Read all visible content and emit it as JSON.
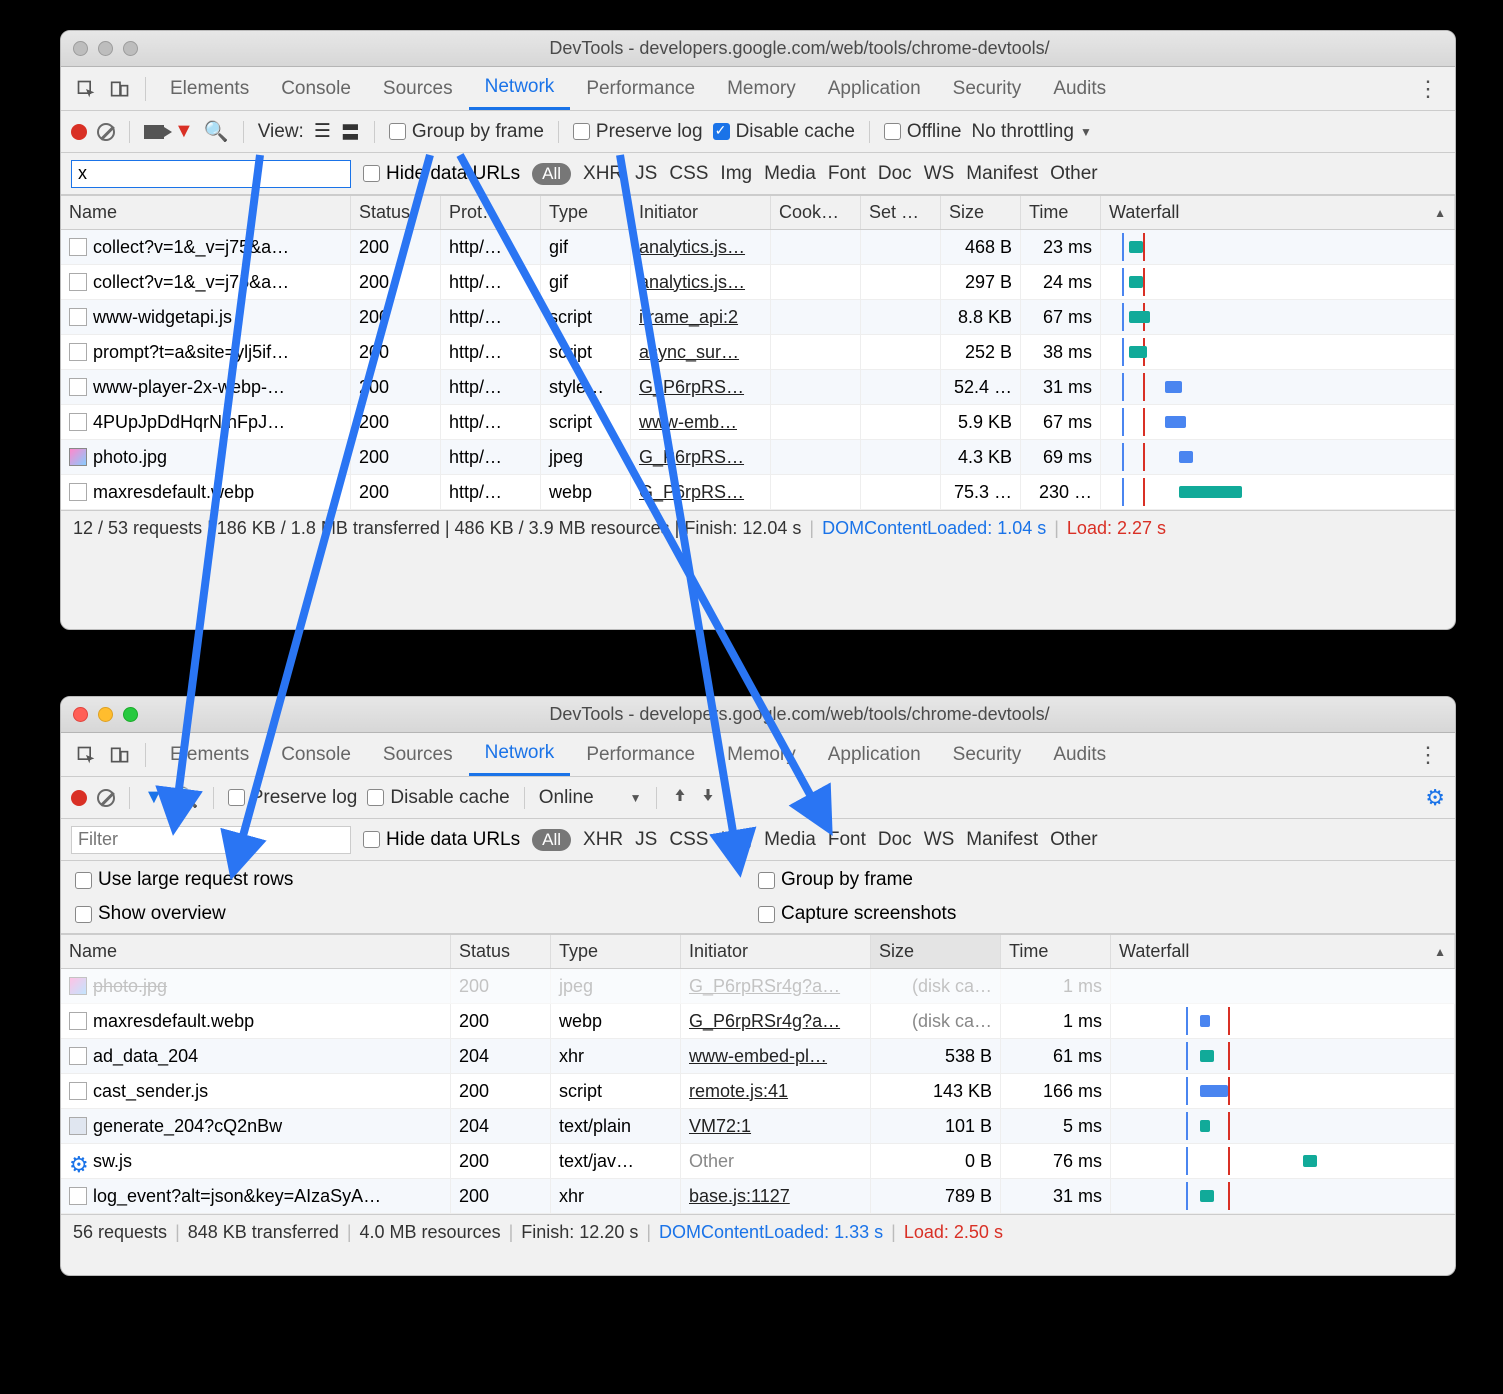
{
  "window1": {
    "title": "DevTools - developers.google.com/web/tools/chrome-devtools/",
    "tabs": [
      "Elements",
      "Console",
      "Sources",
      "Network",
      "Performance",
      "Memory",
      "Application",
      "Security",
      "Audits"
    ],
    "active_tab": "Network",
    "toolbar": {
      "view_label": "View:",
      "group_by_frame": "Group by frame",
      "preserve_log": "Preserve log",
      "disable_cache": "Disable cache",
      "disable_cache_checked": true,
      "offline": "Offline",
      "throttling": "No throttling"
    },
    "filter": {
      "value": "x",
      "hide_data_urls": "Hide data URLs",
      "types": [
        "All",
        "XHR",
        "JS",
        "CSS",
        "Img",
        "Media",
        "Font",
        "Doc",
        "WS",
        "Manifest",
        "Other"
      ]
    },
    "columns": [
      "Name",
      "Status",
      "Prot…",
      "Type",
      "Initiator",
      "Cook…",
      "Set …",
      "Size",
      "Time",
      "Waterfall"
    ],
    "rows": [
      {
        "name": "collect?v=1&_v=j75&a…",
        "status": "200",
        "protocol": "http/…",
        "type": "gif",
        "initiator": "analytics.js…",
        "size": "468 B",
        "time": "23 ms",
        "wf_start": 8,
        "wf_len": 4,
        "color": "#1a9"
      },
      {
        "name": "collect?v=1&_v=j75&a…",
        "status": "200",
        "protocol": "http/…",
        "type": "gif",
        "initiator": "analytics.js…",
        "size": "297 B",
        "time": "24 ms",
        "wf_start": 8,
        "wf_len": 4,
        "color": "#1a9"
      },
      {
        "name": "www-widgetapi.js",
        "status": "200",
        "protocol": "http/…",
        "type": "script",
        "initiator": "iframe_api:2",
        "size": "8.8 KB",
        "time": "67 ms",
        "wf_start": 8,
        "wf_len": 6,
        "color": "#1a9"
      },
      {
        "name": "prompt?t=a&site=ylj5if…",
        "status": "200",
        "protocol": "http/…",
        "type": "script",
        "initiator": "async_sur…",
        "size": "252 B",
        "time": "38 ms",
        "wf_start": 8,
        "wf_len": 5,
        "color": "#1a9"
      },
      {
        "name": "www-player-2x-webp-…",
        "status": "200",
        "protocol": "http/…",
        "type": "style…",
        "initiator": "G_P6rpRS…",
        "size": "52.4 …",
        "time": "31 ms",
        "wf_start": 18,
        "wf_len": 5,
        "color": "#4a85f0"
      },
      {
        "name": "4PUpJpDdHqrNInFpJ…",
        "status": "200",
        "protocol": "http/…",
        "type": "script",
        "initiator": "www-emb…",
        "size": "5.9 KB",
        "time": "67 ms",
        "wf_start": 18,
        "wf_len": 6,
        "color": "#4a85f0"
      },
      {
        "name": "photo.jpg",
        "status": "200",
        "protocol": "http/…",
        "type": "jpeg",
        "initiator": "G_P6rpRS…",
        "size": "4.3 KB",
        "time": "69 ms",
        "wf_start": 22,
        "wf_len": 4,
        "color": "#4a85f0",
        "icon": "jpg"
      },
      {
        "name": "maxresdefault.webp",
        "status": "200",
        "protocol": "http/…",
        "type": "webp",
        "initiator": "G_P6rpRS…",
        "size": "75.3 …",
        "time": "230 …",
        "wf_start": 22,
        "wf_len": 18,
        "color": "#1a9"
      }
    ],
    "status_bar": {
      "text": "12 / 53 requests  |  186 KB / 1.8 MB transferred  |  486 KB / 3.9 MB resources  |  Finish: 12.04 s",
      "dcl": "DOMContentLoaded: 1.04 s",
      "load": "Load: 2.27 s"
    }
  },
  "window2": {
    "title": "DevTools - developers.google.com/web/tools/chrome-devtools/",
    "tabs": [
      "Elements",
      "Console",
      "Sources",
      "Network",
      "Performance",
      "Memory",
      "Application",
      "Security",
      "Audits"
    ],
    "active_tab": "Network",
    "toolbar": {
      "preserve_log": "Preserve log",
      "disable_cache": "Disable cache",
      "online": "Online"
    },
    "filter": {
      "placeholder": "Filter",
      "hide_data_urls": "Hide data URLs",
      "types": [
        "All",
        "XHR",
        "JS",
        "CSS",
        "Img",
        "Media",
        "Font",
        "Doc",
        "WS",
        "Manifest",
        "Other"
      ]
    },
    "options": {
      "large_rows": "Use large request rows",
      "group_by_frame": "Group by frame",
      "show_overview": "Show overview",
      "capture_screenshots": "Capture screenshots"
    },
    "columns": [
      "Name",
      "Status",
      "Type",
      "Initiator",
      "Size",
      "Time",
      "Waterfall"
    ],
    "truncated_row": {
      "name": "photo.jpg",
      "status": "200",
      "type": "jpeg",
      "initiator": "G_P6rpRSr4g?a…",
      "size": "(disk ca…",
      "time": "1 ms"
    },
    "rows": [
      {
        "name": "maxresdefault.webp",
        "status": "200",
        "type": "webp",
        "initiator": "G_P6rpRSr4g?a…",
        "size": "(disk ca…",
        "time": "1 ms",
        "grey": true,
        "wf_start": 26,
        "wf_len": 3,
        "color": "#4a85f0"
      },
      {
        "name": "ad_data_204",
        "status": "204",
        "type": "xhr",
        "initiator": "www-embed-pl…",
        "size": "538 B",
        "time": "61 ms",
        "wf_start": 26,
        "wf_len": 4,
        "color": "#1a9"
      },
      {
        "name": "cast_sender.js",
        "status": "200",
        "type": "script",
        "initiator": "remote.js:41",
        "size": "143 KB",
        "time": "166 ms",
        "wf_start": 26,
        "wf_len": 8,
        "color": "#4a85f0"
      },
      {
        "name": "generate_204?cQ2nBw",
        "status": "204",
        "type": "text/plain",
        "initiator": "VM72:1",
        "size": "101 B",
        "time": "5 ms",
        "wf_start": 26,
        "wf_len": 3,
        "color": "#1a9",
        "icon": "doc"
      },
      {
        "name": "sw.js",
        "status": "200",
        "type": "text/jav…",
        "initiator": "Other",
        "initiator_plain": true,
        "size": "0 B",
        "time": "76 ms",
        "wf_start": 56,
        "wf_len": 4,
        "color": "#1a9",
        "icon": "gear"
      },
      {
        "name": "log_event?alt=json&key=AIzaSyA…",
        "status": "200",
        "type": "xhr",
        "initiator": "base.js:1127",
        "size": "789 B",
        "time": "31 ms",
        "wf_start": 26,
        "wf_len": 4,
        "color": "#1a9"
      }
    ],
    "status_bar": {
      "requests": "56 requests",
      "transferred": "848 KB transferred",
      "resources": "4.0 MB resources",
      "finish": "Finish: 12.20 s",
      "dcl": "DOMContentLoaded: 1.33 s",
      "load": "Load: 2.50 s"
    }
  }
}
